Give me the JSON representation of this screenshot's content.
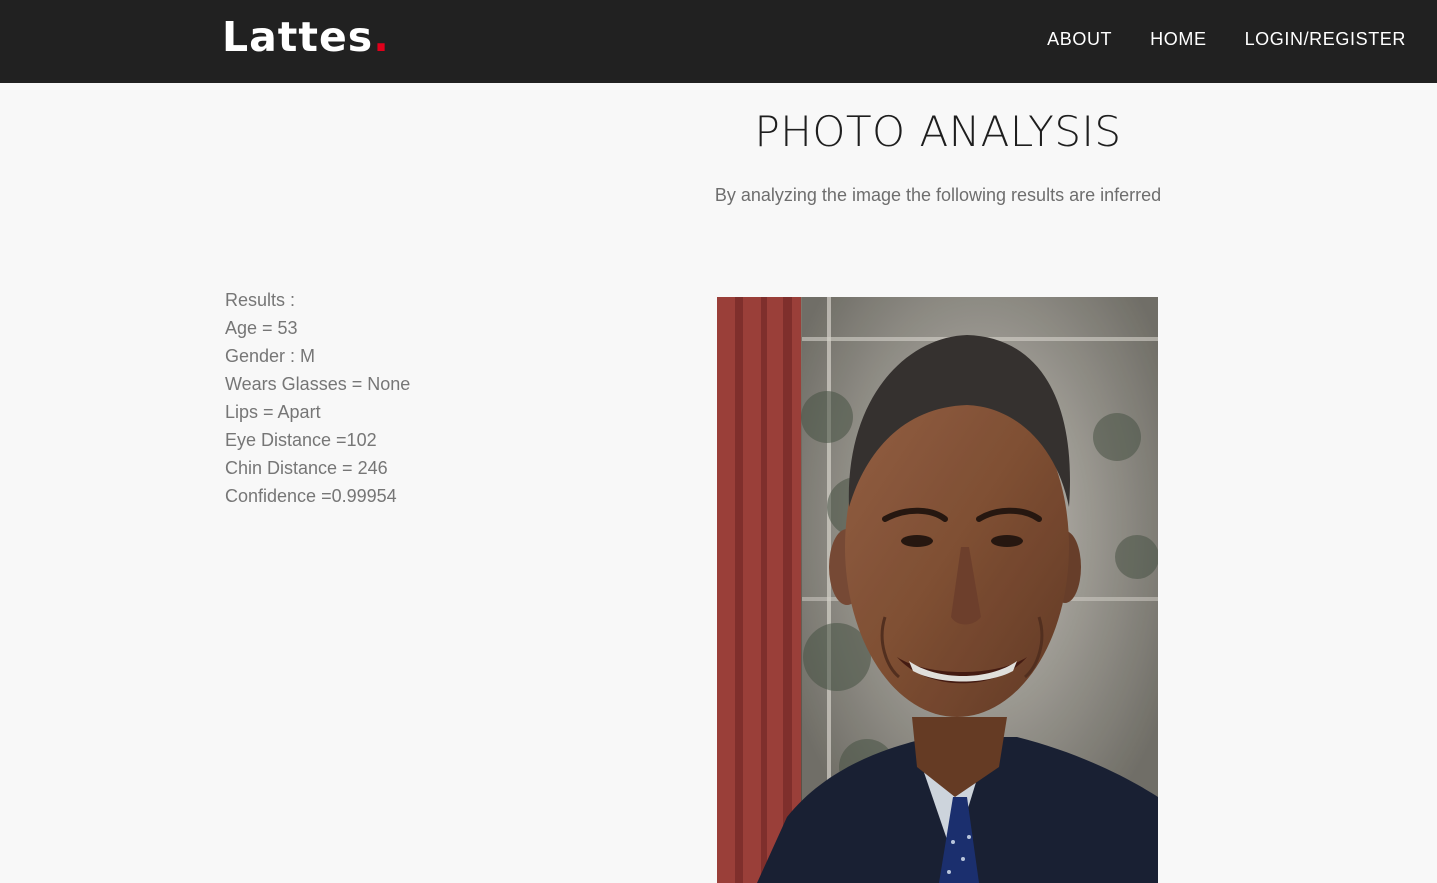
{
  "header": {
    "logo_text": "Lattes",
    "logo_dot": ".",
    "nav": [
      {
        "label": "ABOUT"
      },
      {
        "label": "HOME"
      },
      {
        "label": "LOGIN/REGISTER"
      }
    ]
  },
  "main": {
    "title": "PHOTO ANALYSIS",
    "subtitle": "By analyzing the image the following results are inferred",
    "results": [
      "Results :",
      "Age = 53",
      "Gender : M",
      "Wears Glasses = None",
      "Lips = Apart",
      "Eye Distance =102",
      "Chin Distance = 246",
      "Confidence =0.99954"
    ]
  },
  "colors": {
    "navbar_bg": "#212121",
    "logo_dot": "#e0001b",
    "page_bg": "#f8f8f8"
  }
}
